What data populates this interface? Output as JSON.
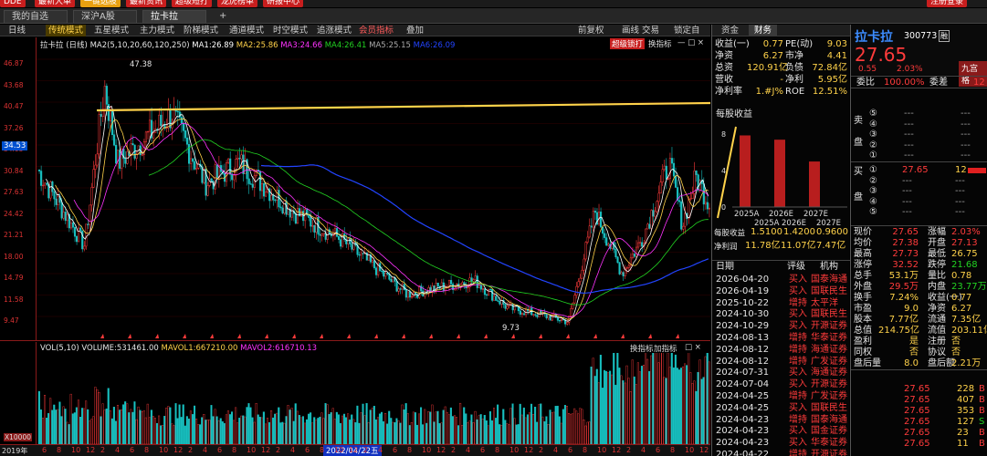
{
  "topbar": {
    "items": [
      "DDE",
      "最新大单",
      "一键选股",
      "最新资讯",
      "超级短打",
      "龙虎榜单",
      "研报中心"
    ],
    "right_button": "注册登录"
  },
  "tabs": [
    "我的自选",
    "深沪A股",
    "拉卡拉"
  ],
  "new_tab": "+",
  "toolbar": {
    "items": [
      "日线",
      "传统模式",
      "五星模式",
      "主力模式",
      "阶梯模式",
      "通道模式",
      "时空模式",
      "追涨模式",
      "会员指标",
      "叠加"
    ],
    "active": "传统模式",
    "right_items": [
      "前复权",
      "画线",
      "交易",
      "锁定自选"
    ]
  },
  "chart_header": {
    "stock": "拉卡拉",
    "period": "(日线)",
    "ma_def": "MA2(5,10,20,60,120,250)",
    "ma1": "MA1:26.89",
    "ma2": "MA2:25.86",
    "ma3": "MA3:24.66",
    "ma4": "MA4:26.41",
    "ma5": "MA5:25.15",
    "ma6": "MA6:26.09",
    "buttons": [
      "超级锁打",
      "换指标"
    ],
    "high_label": "47.38",
    "low_label": "9.73",
    "current_price_label": "34.53"
  },
  "price_axis": [
    "46.87",
    "43.68",
    "40.47",
    "37.26",
    "34.05",
    "30.84",
    "27.63",
    "24.42",
    "21.21",
    "18.00",
    "14.79",
    "11.58",
    "9.47"
  ],
  "volume_header": {
    "vol": "VOL(5,10)",
    "volume": "VOLUME:531461.00",
    "mavol1": "MAVOL1:667210.00",
    "mavol2": "MAVOL2:616710.13",
    "buttons": [
      "换指标",
      "加指标"
    ],
    "unit": "X10000"
  },
  "x_axis": {
    "start": "2019年",
    "ticks": [
      "6",
      "8",
      "10",
      "12",
      "2",
      "4",
      "6",
      "8",
      "10",
      "12",
      "2",
      "4",
      "6",
      "8",
      "10",
      "12",
      "2",
      "4",
      "6",
      "8",
      "10",
      "12",
      "2",
      "4",
      "6",
      "8",
      "10",
      "12",
      "2",
      "4",
      "6",
      "8",
      "10",
      "12",
      "2",
      "4",
      "6",
      "8",
      "10",
      "12",
      "2",
      "4",
      "6",
      "8",
      "10",
      "12"
    ],
    "highlight": "2022/04/22五"
  },
  "fundamentals": {
    "tabs": [
      "资金",
      "财务"
    ],
    "active_tab": "财务",
    "rows": [
      {
        "l1": "收益(一)",
        "v1": "0.77",
        "l2": "PE(动)",
        "v2": "9.03"
      },
      {
        "l1": "净资",
        "v1": "6.27",
        "l2": "市净",
        "v2": "4.41"
      },
      {
        "l1": "总资",
        "v1": "120.91亿",
        "l2": "负债",
        "v2": "72.84亿"
      },
      {
        "l1": "营收",
        "v1": "-",
        "l2": "净利",
        "v2": "5.95亿"
      },
      {
        "l1": "净利率",
        "v1": "1.#J%",
        "l2": "ROE",
        "v2": "12.51%"
      }
    ],
    "eps_title": "每股收益",
    "eps_years": [
      "2025A",
      "2026E",
      "2027E"
    ],
    "eps_values": [
      1.51,
      1.42,
      0.96
    ],
    "eps_axis": [
      "8",
      "4",
      "0"
    ],
    "eps_row_label": "每股收益",
    "eps_row": [
      "1.5100",
      "1.4200",
      "0.9600"
    ],
    "np_row_label": "净利润",
    "np_row": [
      "11.78亿",
      "11.07亿",
      "7.47亿"
    ]
  },
  "ratings": {
    "headers": [
      "日期",
      "评级",
      "机构"
    ],
    "rows": [
      {
        "date": "2026-04-20",
        "rating": "买入",
        "org": "国泰海通"
      },
      {
        "date": "2026-04-19",
        "rating": "买入",
        "org": "国联民生"
      },
      {
        "date": "2025-10-22",
        "rating": "增持",
        "org": "太平洋"
      },
      {
        "date": "2024-10-30",
        "rating": "买入",
        "org": "国联民生"
      },
      {
        "date": "2024-10-29",
        "rating": "买入",
        "org": "开源证券"
      },
      {
        "date": "2024-08-13",
        "rating": "增持",
        "org": "华泰证券"
      },
      {
        "date": "2024-08-12",
        "rating": "增持",
        "org": "海通证券"
      },
      {
        "date": "2024-08-12",
        "rating": "增持",
        "org": "广发证券"
      },
      {
        "date": "2024-07-31",
        "rating": "买入",
        "org": "海通证券"
      },
      {
        "date": "2024-07-04",
        "rating": "买入",
        "org": "开源证券"
      },
      {
        "date": "2024-04-25",
        "rating": "增持",
        "org": "广发证券"
      },
      {
        "date": "2024-04-25",
        "rating": "买入",
        "org": "国联民生"
      },
      {
        "date": "2024-04-23",
        "rating": "增持",
        "org": "国泰海通"
      },
      {
        "date": "2024-04-23",
        "rating": "买入",
        "org": "国金证券"
      },
      {
        "date": "2024-04-23",
        "rating": "买入",
        "org": "华泰证券"
      },
      {
        "date": "2024-04-22",
        "rating": "增持",
        "org": "开源证券"
      }
    ]
  },
  "quote": {
    "name": "拉卡拉",
    "code": "300773",
    "flag": "融",
    "price": "27.65",
    "change": "0.55",
    "pct": "2.03%",
    "right_button": "九宫格",
    "weibi_label": "委比",
    "weibi": "100.00%",
    "weicha_label": "委差",
    "weicha": "12",
    "sell_label": [
      "卖",
      "盘"
    ],
    "sell": [
      {
        "n": "⑤",
        "p": "---",
        "v": "---"
      },
      {
        "n": "④",
        "p": "---",
        "v": "---"
      },
      {
        "n": "③",
        "p": "---",
        "v": "---"
      },
      {
        "n": "②",
        "p": "---",
        "v": "---"
      },
      {
        "n": "①",
        "p": "---",
        "v": "---"
      }
    ],
    "buy_label": [
      "买",
      "盘"
    ],
    "buy": [
      {
        "n": "①",
        "p": "27.65",
        "v": "12"
      },
      {
        "n": "②",
        "p": "---",
        "v": "---"
      },
      {
        "n": "③",
        "p": "---",
        "v": "---"
      },
      {
        "n": "④",
        "p": "---",
        "v": "---"
      },
      {
        "n": "⑤",
        "p": "---",
        "v": "---"
      }
    ],
    "stats": [
      {
        "l1": "现价",
        "v1": "27.65",
        "l2": "涨幅",
        "v2": "2.03%"
      },
      {
        "l1": "均价",
        "v1": "27.38",
        "l2": "开盘",
        "v2": "27.13"
      },
      {
        "l1": "最高",
        "v1": "27.73",
        "l2": "最低",
        "v2": "26.75"
      },
      {
        "l1": "涨停",
        "v1": "32.52",
        "l2": "跌停",
        "v2": "21.68"
      },
      {
        "l1": "总手",
        "v1": "53.1万",
        "l2": "量比",
        "v2": "0.78"
      },
      {
        "l1": "外盘",
        "v1": "29.5万",
        "l2": "内盘",
        "v2": "23.77万"
      },
      {
        "l1": "换手",
        "v1": "7.24%",
        "l2": "收益(一)",
        "v2": "0.77"
      },
      {
        "l1": "市盈",
        "v1": "9.0",
        "l2": "净资",
        "v2": "6.27"
      },
      {
        "l1": "股本",
        "v1": "7.77亿",
        "l2": "流通",
        "v2": "7.35亿"
      },
      {
        "l1": "总值",
        "v1": "214.75亿",
        "l2": "流值",
        "v2": "203.11亿"
      },
      {
        "l1": "盈利",
        "v1": "是",
        "l2": "注册",
        "v2": "否"
      },
      {
        "l1": "同权",
        "v1": "否",
        "l2": "协议",
        "v2": "否"
      },
      {
        "l1": "盘后量",
        "v1": "8.0",
        "l2": "盘后额",
        "v2": "2.21万"
      }
    ],
    "ticks": [
      {
        "p": "27.65",
        "v": "228",
        "d": "B"
      },
      {
        "p": "27.65",
        "v": "407",
        "d": "B"
      },
      {
        "p": "27.65",
        "v": "353",
        "d": "B"
      },
      {
        "p": "27.65",
        "v": "127",
        "d": "S"
      },
      {
        "p": "27.65",
        "v": "23",
        "d": "B"
      },
      {
        "p": "27.65",
        "v": "11",
        "d": "B"
      }
    ]
  },
  "colors": {
    "up": "#ff3b3b",
    "down": "#22d222",
    "accent": "#ffd24a",
    "ma_lines": [
      "#ffffff",
      "#ffd24a",
      "#ff33ff",
      "#22d222",
      "#aaaaaa",
      "#2244ff"
    ]
  }
}
